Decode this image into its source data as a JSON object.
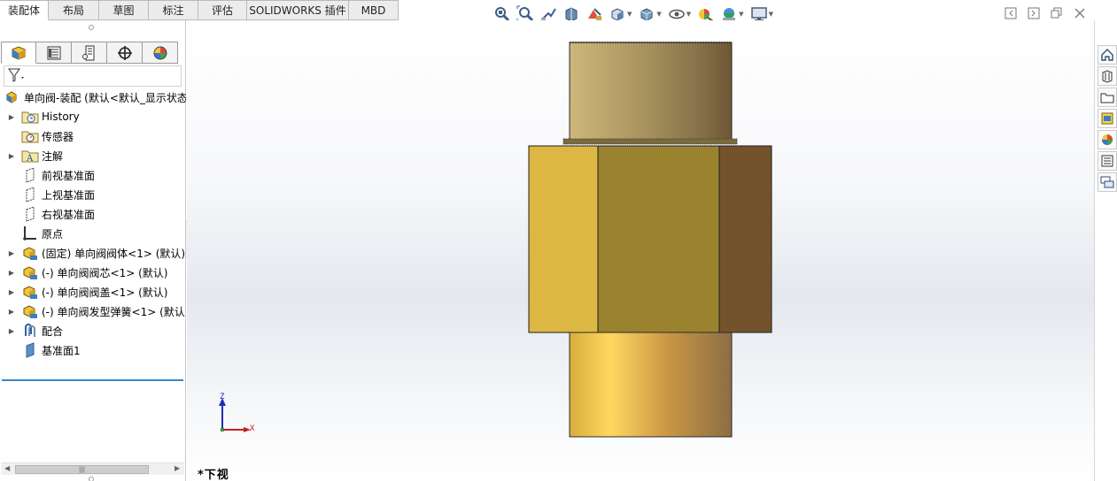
{
  "command_tabs": [
    {
      "label": "装配体",
      "active": true
    },
    {
      "label": "布局",
      "active": false
    },
    {
      "label": "草图",
      "active": false
    },
    {
      "label": "标注",
      "active": false
    },
    {
      "label": "评估",
      "active": false
    },
    {
      "label": "SOLIDWORKS 插件",
      "active": false
    },
    {
      "label": "MBD",
      "active": false
    }
  ],
  "view_toolbar_icons": [
    "zoom-to-fit-icon",
    "zoom-to-area-icon",
    "previous-view-icon",
    "section-view-icon",
    "dynamic-annotation-icon",
    "view-orientation-icon",
    "display-style-icon",
    "hide-show-icon",
    "edit-appearance-icon",
    "apply-scene-icon",
    "view-settings-icon"
  ],
  "window_controls": [
    "tile-left-icon",
    "tile-right-icon",
    "restore-icon",
    "close-icon"
  ],
  "panel_tabs": [
    "feature-manager-icon",
    "property-manager-icon",
    "configuration-manager-icon",
    "dimxpert-icon",
    "display-manager-icon"
  ],
  "tree": {
    "root": "单向阀-装配  (默认<默认_显示状态",
    "items": [
      {
        "label": "History",
        "icon": "history-folder-icon",
        "expand": true
      },
      {
        "label": "传感器",
        "icon": "sensor-icon",
        "expand": false
      },
      {
        "label": "注解",
        "icon": "annotations-icon",
        "expand": true
      },
      {
        "label": "前视基准面",
        "icon": "plane-icon",
        "expand": false
      },
      {
        "label": "上视基准面",
        "icon": "plane-icon",
        "expand": false
      },
      {
        "label": "右视基准面",
        "icon": "plane-icon",
        "expand": false
      },
      {
        "label": "原点",
        "icon": "origin-icon",
        "expand": false
      },
      {
        "label": "(固定) 单向阀阀体<1> (默认)",
        "icon": "part-icon",
        "expand": true
      },
      {
        "label": "(-) 单向阀阀芯<1> (默认)",
        "icon": "part-icon",
        "expand": true
      },
      {
        "label": "(-) 单向阀阀盖<1> (默认)",
        "icon": "part-icon",
        "expand": true
      },
      {
        "label": "(-) 单向阀发型弹簧<1> (默认",
        "icon": "part-icon",
        "expand": true
      },
      {
        "label": "配合",
        "icon": "mates-icon",
        "expand": true
      },
      {
        "label": "基准面1",
        "icon": "plane-icon",
        "expand": false
      }
    ]
  },
  "graphics": {
    "view_name": "*下视",
    "triad_axes": {
      "z": "Z",
      "x": "X"
    }
  },
  "task_pane_icons": [
    "solidworks-resources-icon",
    "design-library-icon",
    "file-explorer-icon",
    "view-palette-icon",
    "appearances-icon",
    "custom-properties-icon",
    "forum-icon"
  ],
  "colors": {
    "accent_blue": "#3a87c6",
    "brass_light": "#ddb744",
    "brass_mid": "#9a822f",
    "brass_dark": "#74532c"
  }
}
